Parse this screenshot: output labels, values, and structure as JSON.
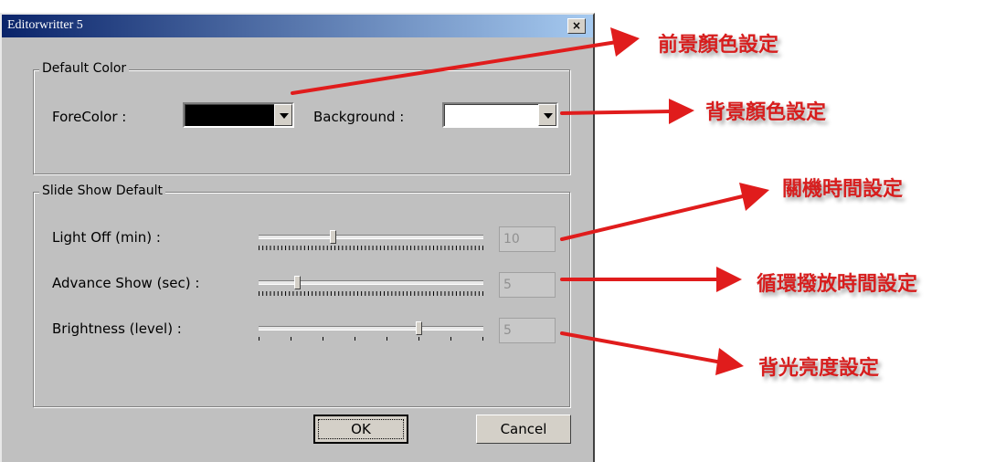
{
  "window": {
    "title": "Editorwritter 5",
    "close_glyph": "×"
  },
  "default_color": {
    "legend": "Default Color",
    "fore_label": "ForeColor :",
    "fore_color": "#000000",
    "back_label": "Background :",
    "back_color": "#ffffff"
  },
  "slide_show": {
    "legend": "Slide Show Default",
    "rows": [
      {
        "label": "Light Off (min) :",
        "value": "10",
        "position": 0.33
      },
      {
        "label": "Advance Show (sec) :",
        "value": "5",
        "position": 0.17
      },
      {
        "label": "Brightness (level) :",
        "value": "5",
        "position": 0.71
      }
    ]
  },
  "buttons": {
    "ok": "OK",
    "cancel": "Cancel"
  },
  "annotations": [
    {
      "text": "前景顏色設定"
    },
    {
      "text": "背景顏色設定"
    },
    {
      "text": "關機時間設定"
    },
    {
      "text": "循環撥放時間設定"
    },
    {
      "text": "背光亮度設定"
    }
  ],
  "colors": {
    "annotation": "#d71e1e",
    "titlebar_start": "#0a246a",
    "titlebar_end": "#a6caf0"
  }
}
